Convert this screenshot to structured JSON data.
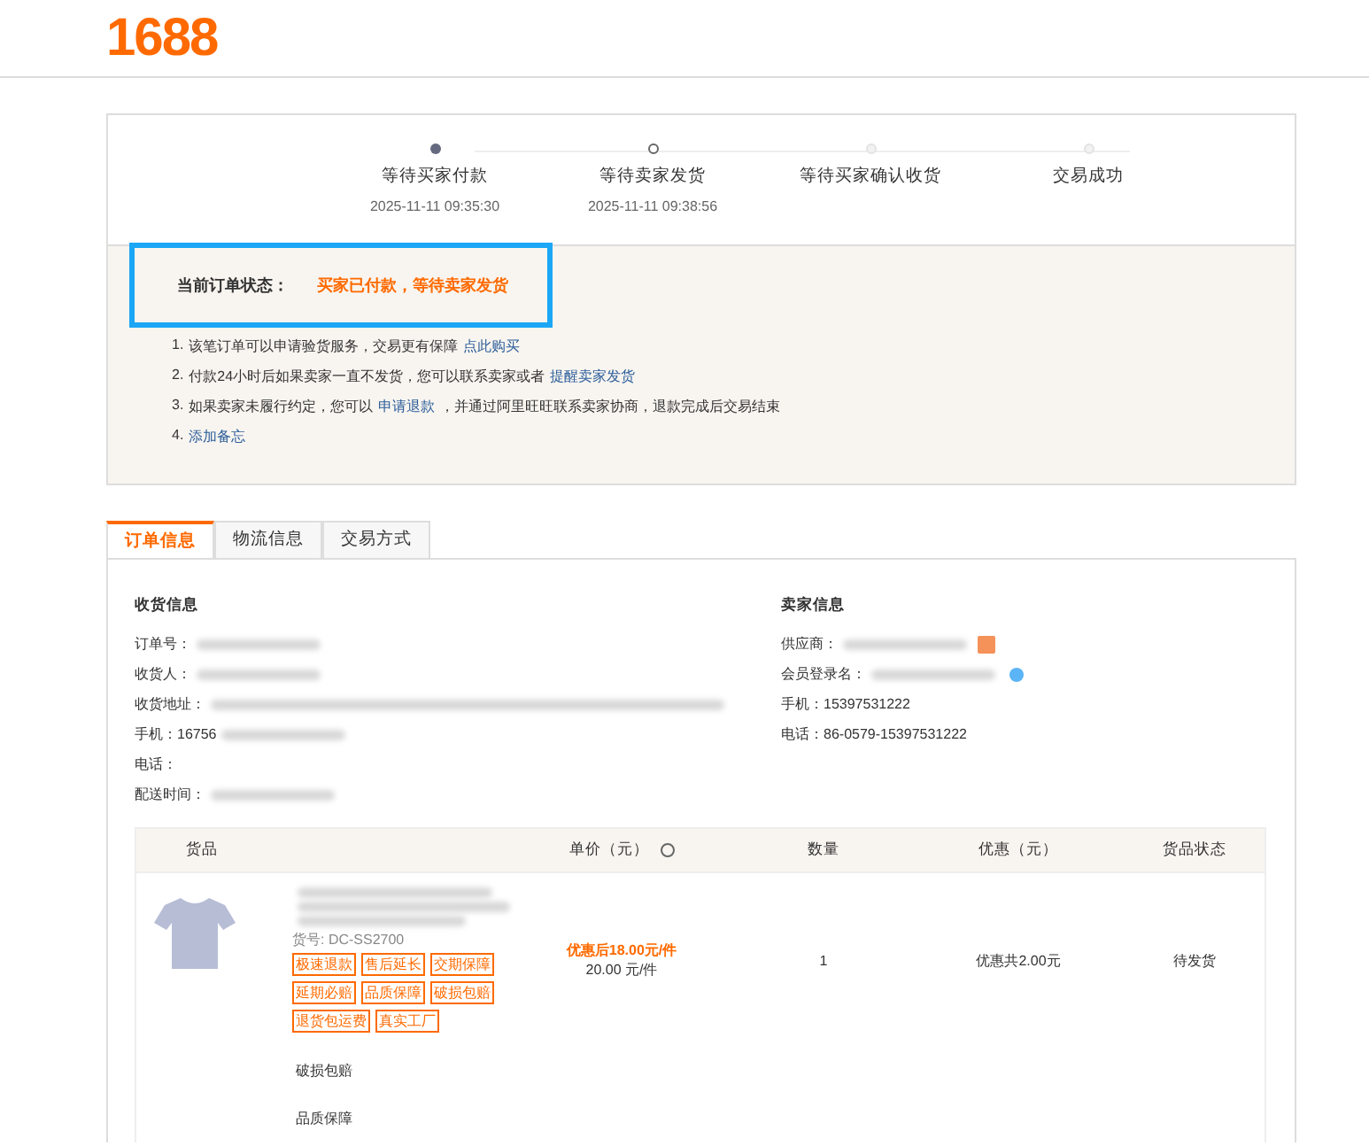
{
  "logo": "1688",
  "steps": [
    {
      "label": "等待买家付款",
      "time": "2025-11-11 09:35:30",
      "kind": "done"
    },
    {
      "label": "等待卖家发货",
      "time": "2025-11-11 09:38:56",
      "kind": "current"
    },
    {
      "label": "等待买家确认收货",
      "kind": "pending"
    },
    {
      "label": "交易成功",
      "kind": "pending"
    }
  ],
  "status": {
    "label": "当前订单状态：",
    "value": "买家已付款，等待卖家发货",
    "highlighted": true
  },
  "notes": [
    {
      "number": "1.",
      "text": "该笔订单可以申请验货服务，交易更有保障",
      "link": "点此购买"
    },
    {
      "number": "2.",
      "text": "付款24小时后如果卖家一直不发货，您可以联系卖家或者",
      "link": "提醒卖家发货"
    },
    {
      "number": "3.",
      "text": "如果卖家未履行约定，您可以",
      "link": "申请退款",
      "after": "，并通过阿里旺旺联系卖家协商，退款完成后交易结束"
    },
    {
      "number": "4.",
      "link": "添加备忘"
    }
  ],
  "tabs": [
    {
      "label": "订单信息",
      "selected": true
    },
    {
      "label": "物流信息",
      "selected": false
    },
    {
      "label": "交易方式",
      "selected": false
    }
  ],
  "buyer": {
    "title": "收货信息",
    "fields": [
      {
        "label": "订单号：",
        "redacted": true
      },
      {
        "label": "收货人：",
        "redacted": true
      },
      {
        "label": "收货地址：",
        "redacted": true,
        "wide": true
      },
      {
        "label": "手机：",
        "value": "16756",
        "redacted": true
      },
      {
        "label": "电话："
      },
      {
        "label": "配送时间：",
        "redacted": true
      }
    ]
  },
  "seller": {
    "title": "卖家信息",
    "fields": [
      {
        "label": "供应商：",
        "redacted": true,
        "kind": "chat"
      },
      {
        "label": "会员登录名：",
        "redacted": true,
        "kind": "verified"
      },
      {
        "label": "手机：",
        "value": "15397531222"
      },
      {
        "label": "电话：",
        "value": "86-0579-15397531222"
      }
    ]
  },
  "table": {
    "columns": [
      "货品",
      "单价（元）",
      "数量",
      "优惠（元）",
      "货品状态"
    ],
    "rows": [
      {
        "sku": "货号: DC-SS2700",
        "tags": [
          "极速退款",
          "售后延长",
          "交期保障",
          "延期必赔",
          "品质保障",
          "破损包赔",
          "退货包运费",
          "真实工厂"
        ],
        "price_after": "优惠后18.00元/件",
        "price": "20.00 元/件",
        "quantity": "1",
        "discount": "优惠共2.00元",
        "status": "待发货"
      }
    ],
    "services": [
      "破损包赔",
      "品质保障"
    ]
  }
}
